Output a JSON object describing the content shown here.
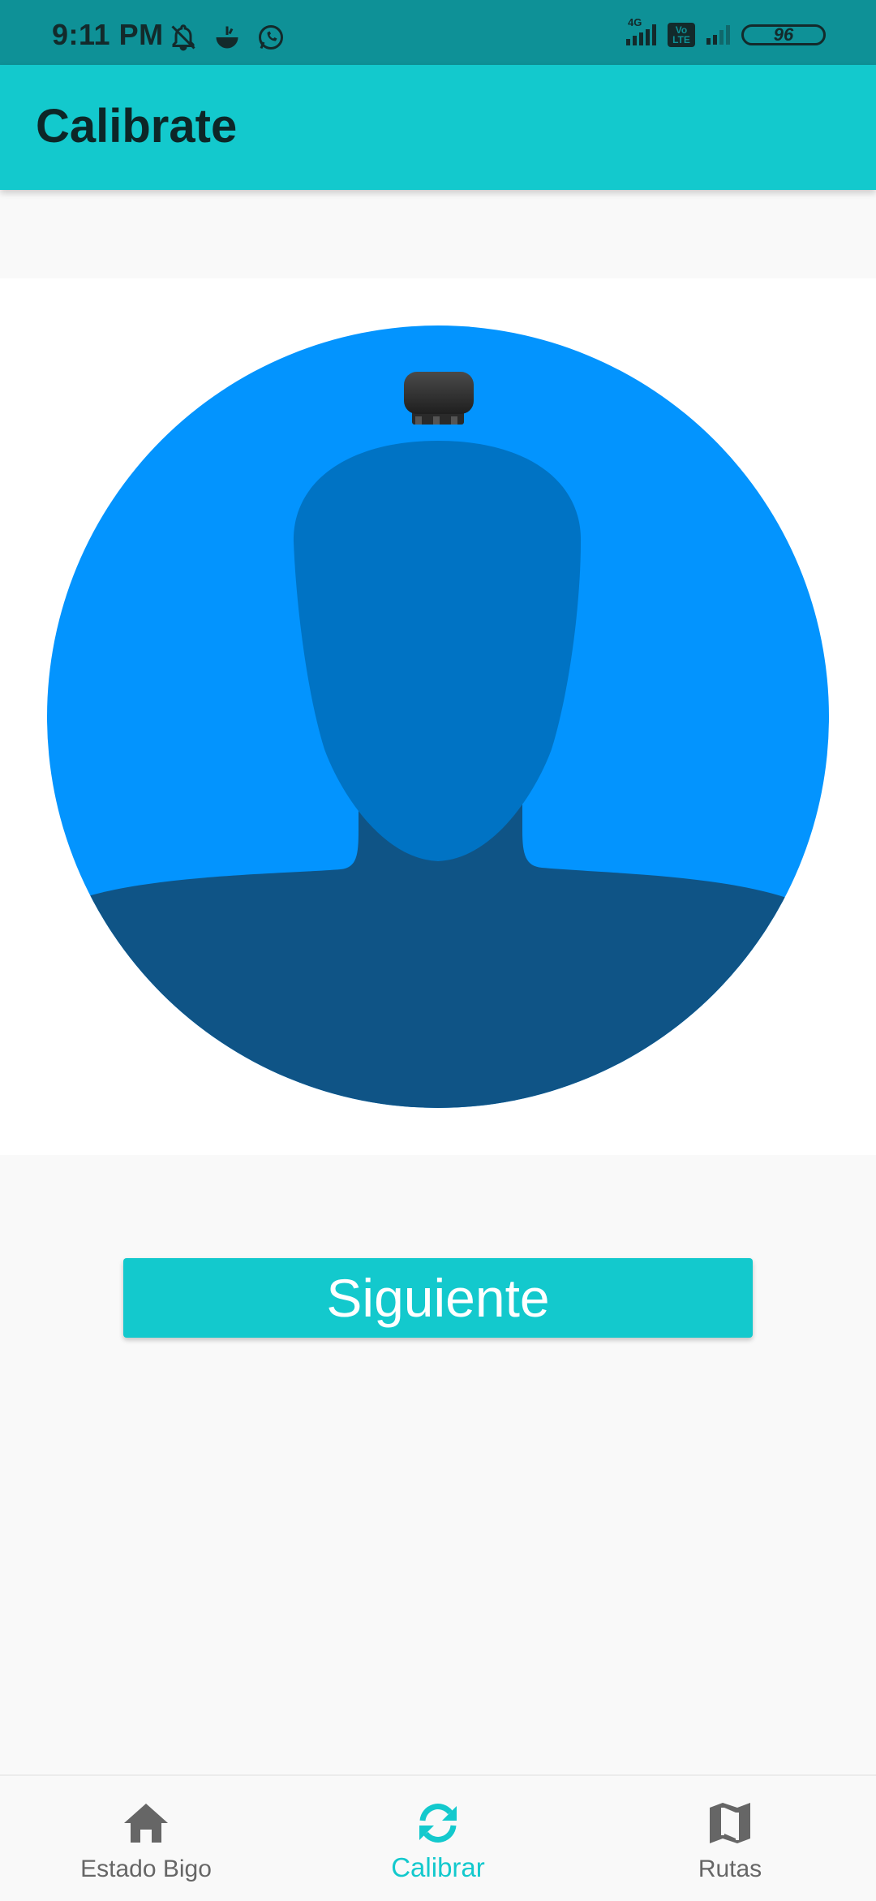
{
  "status_bar": {
    "time": "9:11 PM",
    "left_icons": [
      "mute-icon",
      "weather-icon",
      "whatsapp-icon"
    ],
    "network_label": "4G",
    "volte_label": "Vo LTE",
    "battery": "96"
  },
  "app_bar": {
    "title": "Calibrate"
  },
  "calibration_image": {
    "description_icon": "person-with-head-device"
  },
  "actions": {
    "next_label": "Siguiente"
  },
  "bottom_nav": {
    "items": [
      {
        "label": "Estado Bigo",
        "icon": "home-icon",
        "active": false
      },
      {
        "label": "Calibrar",
        "icon": "sync-icon",
        "active": true
      },
      {
        "label": "Rutas",
        "icon": "map-icon",
        "active": false
      }
    ]
  },
  "colors": {
    "accent": "#13c9cd",
    "status_bar": "#0e9197",
    "avatar_bg": "#0394fe",
    "avatar_head": "#0073c4",
    "avatar_body": "#0f5486",
    "nav_inactive": "#666666"
  }
}
